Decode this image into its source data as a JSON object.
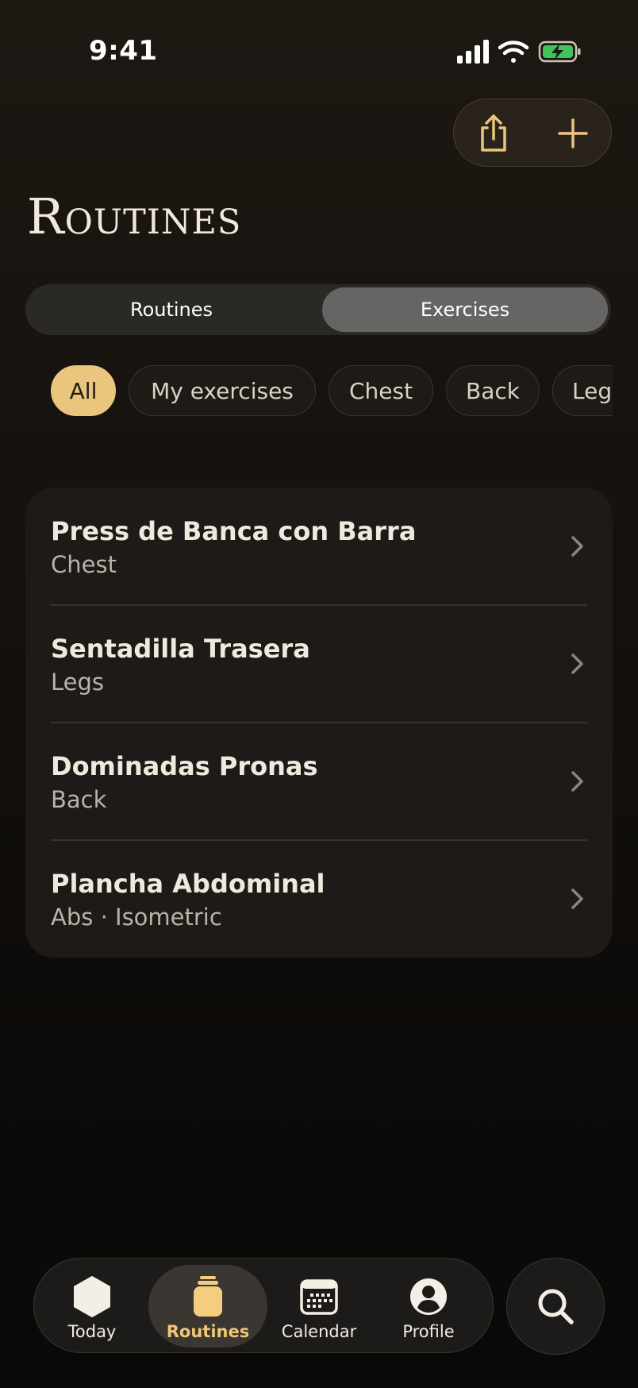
{
  "status_bar": {
    "time": "9:41"
  },
  "page": {
    "title": "Routines"
  },
  "segments": {
    "routines_label": "Routines",
    "exercises_label": "Exercises",
    "selected": "Exercises"
  },
  "filters": [
    {
      "label": "All",
      "active": true
    },
    {
      "label": "My exercises",
      "active": false
    },
    {
      "label": "Chest",
      "active": false
    },
    {
      "label": "Back",
      "active": false
    },
    {
      "label": "Legs",
      "active": false
    }
  ],
  "exercises": [
    {
      "name": "Press de Banca con Barra",
      "category": "Chest"
    },
    {
      "name": "Sentadilla Trasera",
      "category": "Legs"
    },
    {
      "name": "Dominadas Pronas",
      "category": "Back"
    },
    {
      "name": "Plancha Abdominal",
      "category": "Abs · Isometric"
    }
  ],
  "tab_bar": {
    "tabs": [
      {
        "label": "Today",
        "icon": "hexagon-icon"
      },
      {
        "label": "Routines",
        "icon": "jar-icon",
        "active": true
      },
      {
        "label": "Calendar",
        "icon": "calendar-icon"
      },
      {
        "label": "Profile",
        "icon": "profile-icon"
      }
    ],
    "search_icon": "search-icon"
  },
  "colors": {
    "accent": "#e9c57e",
    "battery": "#3fc55a",
    "card": "#1d1a17"
  }
}
